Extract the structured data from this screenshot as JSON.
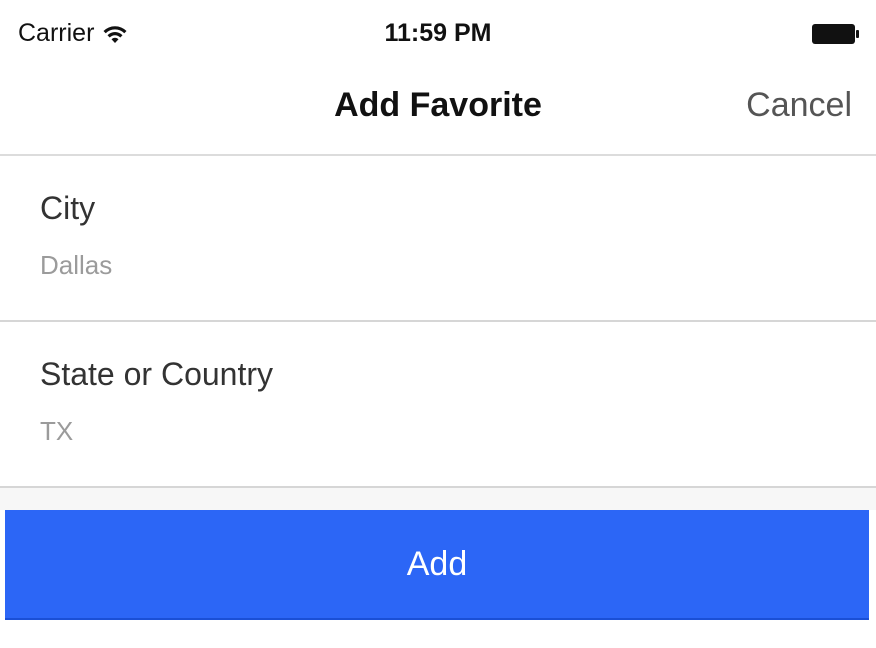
{
  "status_bar": {
    "carrier": "Carrier",
    "time": "11:59 PM",
    "wifi_icon": "wifi-icon",
    "battery_icon": "battery-icon"
  },
  "nav": {
    "title": "Add Favorite",
    "cancel_label": "Cancel"
  },
  "form": {
    "city": {
      "label": "City",
      "value": "Dallas"
    },
    "state": {
      "label": "State or Country",
      "value": "TX"
    }
  },
  "actions": {
    "add_label": "Add"
  },
  "colors": {
    "accent": "#2c66f6",
    "placeholder_text": "#9b9b9b",
    "divider": "#d6d6d6"
  }
}
